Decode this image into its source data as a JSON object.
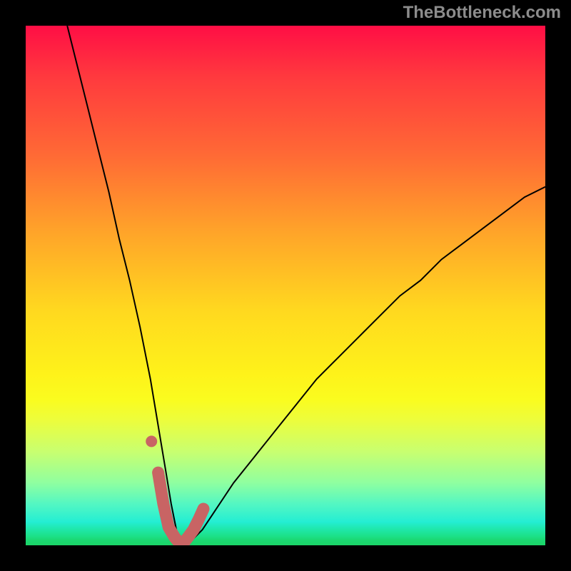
{
  "watermark": {
    "text": "TheBottleneck.com"
  },
  "chart_data": {
    "type": "line",
    "title": "",
    "xlabel": "",
    "ylabel": "",
    "xlim": [
      0,
      100
    ],
    "ylim": [
      0,
      100
    ],
    "grid": false,
    "series": [
      {
        "name": "curve",
        "color": "#000000",
        "x": [
          8,
          10,
          12,
          14,
          16,
          18,
          20,
          22,
          24,
          25,
          26,
          27,
          28,
          29,
          30,
          31,
          32,
          34,
          36,
          40,
          44,
          48,
          52,
          56,
          60,
          64,
          68,
          72,
          76,
          80,
          84,
          88,
          92,
          96,
          100
        ],
        "y": [
          100,
          92,
          84,
          76,
          68,
          59,
          51,
          42,
          32,
          26,
          20,
          14,
          8,
          3,
          0,
          0,
          1,
          3,
          6,
          12,
          17,
          22,
          27,
          32,
          36,
          40,
          44,
          48,
          51,
          55,
          58,
          61,
          64,
          67,
          69
        ]
      }
    ],
    "marker_region": {
      "name": "highlight",
      "color": "#c86464",
      "x": [
        25.5,
        26.5,
        27.5,
        28.7,
        30,
        31.2,
        32.3,
        33.3,
        34.2
      ],
      "y": [
        14,
        8,
        3.5,
        1.5,
        0,
        1.5,
        3,
        5,
        7
      ]
    },
    "marker_dot": {
      "color": "#c86464",
      "x": 24.2,
      "y": 20
    },
    "background": "rainbow-gradient-vertical"
  }
}
